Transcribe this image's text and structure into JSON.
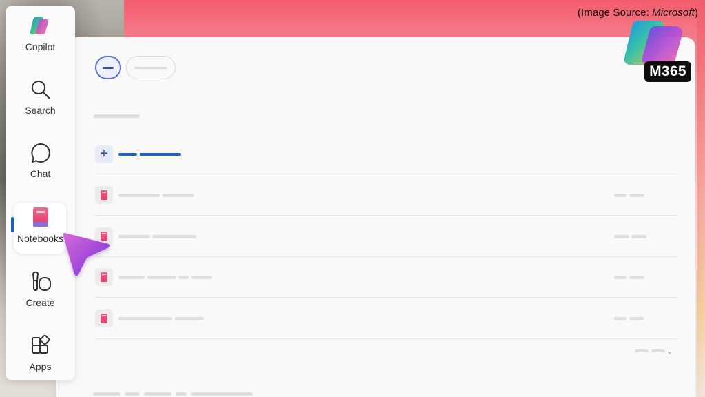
{
  "source_credit": {
    "prefix": "(Image Source: ",
    "brand": "Microsoft",
    "suffix": ")"
  },
  "sidebar": {
    "items": [
      {
        "label": "Copilot",
        "icon": "copilot-logo-icon",
        "active": false
      },
      {
        "label": "Search",
        "icon": "search-icon",
        "active": false
      },
      {
        "label": "Chat",
        "icon": "chat-bubble-icon",
        "active": false
      },
      {
        "label": "Notebooks",
        "icon": "notebook-icon",
        "active": true
      },
      {
        "label": "Create",
        "icon": "create-brush-icon",
        "active": false
      },
      {
        "label": "Apps",
        "icon": "apps-grid-icon",
        "active": false
      }
    ]
  },
  "badge": {
    "text": "M365"
  },
  "colors": {
    "accent": "#1b64c4",
    "pill_border": "#5b6ad6",
    "notebook_pink": "#e0436a",
    "background_top": "#f25c6e"
  }
}
